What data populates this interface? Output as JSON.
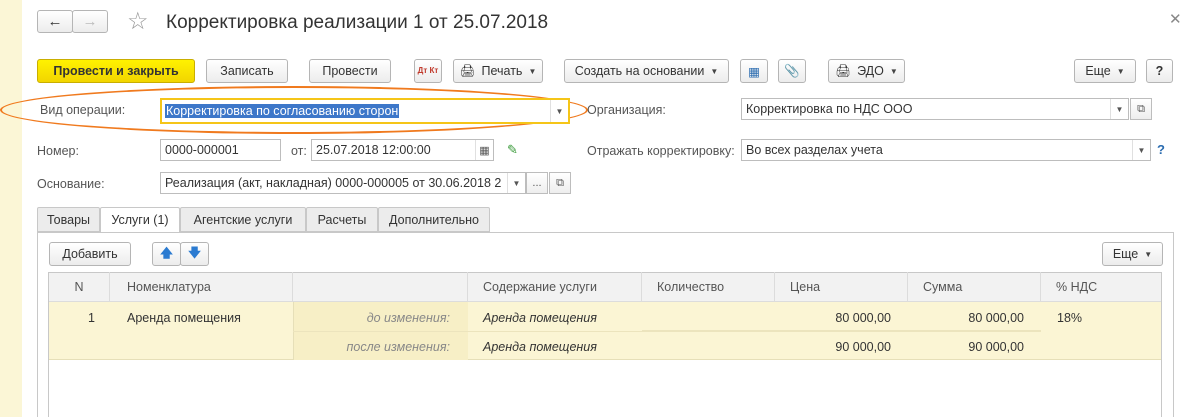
{
  "title": "Корректировка реализации 1 от 25.07.2018",
  "toolbar": {
    "post_close": "Провести и закрыть",
    "save": "Записать",
    "post": "Провести",
    "dtkt": "Дт Кт",
    "print": "Печать",
    "create_based": "Создать на основании",
    "edo": "ЭДО",
    "more": "Еще",
    "help": "?"
  },
  "form": {
    "op_type_label": "Вид операции:",
    "op_type_value": "Корректировка по согласованию сторон",
    "org_label": "Организация:",
    "org_value": "Корректировка по НДС ООО",
    "number_label": "Номер:",
    "number_value": "0000-000001",
    "date_label": "от:",
    "date_value": "25.07.2018 12:00:00",
    "reflect_label": "Отражать корректировку:",
    "reflect_value": "Во всех разделах учета",
    "help": "?",
    "basis_label": "Основание:",
    "basis_value": "Реализация (акт, накладная) 0000-000005 от 30.06.2018 2",
    "ellipsis": "..."
  },
  "tabs": [
    "Товары",
    "Услуги (1)",
    "Агентские услуги",
    "Расчеты",
    "Дополнительно"
  ],
  "table_toolbar": {
    "add": "Добавить",
    "more": "Еще"
  },
  "table": {
    "headers": [
      "N",
      "Номенклатура",
      "",
      "Содержание услуги",
      "Количество",
      "Цена",
      "Сумма",
      "% НДС"
    ],
    "row": {
      "n": "1",
      "item": "Аренда помещения",
      "before_label": "до изменения:",
      "after_label": "после изменения:",
      "content_before": "Аренда помещения",
      "content_after": "Аренда помещения",
      "price_before": "80 000,00",
      "price_after": "90 000,00",
      "sum_before": "80 000,00",
      "sum_after": "90 000,00",
      "vat": "18%"
    }
  },
  "colors": {
    "highlight_ellipse": "#f07a1e",
    "primary_button": "#f7dd00",
    "row_bg": "#fbf5d4",
    "selection": "#3d77c9"
  }
}
